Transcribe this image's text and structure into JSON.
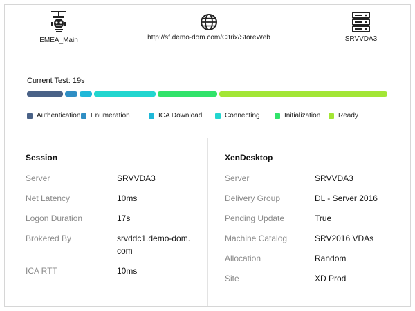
{
  "topology": {
    "site": {
      "label": "EMEA_Main",
      "icon": "robot-monitor-icon"
    },
    "url": {
      "label": "http://sf.demo-dom.com/Citrix/StoreWeb",
      "icon": "globe-icon"
    },
    "server": {
      "label": "SRVVDA3",
      "icon": "server-icon"
    }
  },
  "current_test": {
    "label": "Current Test:",
    "value": "19s"
  },
  "progress": {
    "segments": [
      {
        "name": "Authentication",
        "color": "#4a6287",
        "fraction": 0.105
      },
      {
        "name": "Enumeration",
        "color": "#2f8ec4",
        "fraction": 0.04
      },
      {
        "name": "ICA Download",
        "color": "#1fb8d8",
        "fraction": 0.04
      },
      {
        "name": "Connecting",
        "color": "#22d6cf",
        "fraction": 0.175
      },
      {
        "name": "Initialization",
        "color": "#31e36a",
        "fraction": 0.17
      },
      {
        "name": "Ready",
        "color": "#a3e635",
        "fraction": 0.465
      }
    ]
  },
  "legend": [
    {
      "label": "Authentication",
      "color": "#4a6287"
    },
    {
      "label": "Enumeration",
      "color": "#2f8ec4"
    },
    {
      "label": "ICA Download",
      "color": "#1fb8d8"
    },
    {
      "label": "Connecting",
      "color": "#22d6cf"
    },
    {
      "label": "Initialization",
      "color": "#31e36a"
    },
    {
      "label": "Ready",
      "color": "#a3e635"
    }
  ],
  "session": {
    "title": "Session",
    "rows": [
      {
        "key": "Server",
        "value": "SRVVDA3"
      },
      {
        "key": "Net Latency",
        "value": "10ms"
      },
      {
        "key": "Logon Duration",
        "value": "17s"
      },
      {
        "key": "Brokered By",
        "value": "srvddc1.demo-dom.com"
      },
      {
        "key": "ICA RTT",
        "value": "10ms"
      }
    ]
  },
  "xendesktop": {
    "title": "XenDesktop",
    "rows": [
      {
        "key": "Server",
        "value": "SRVVDA3"
      },
      {
        "key": "Delivery Group",
        "value": "DL - Server 2016"
      },
      {
        "key": "Pending Update",
        "value": "True"
      },
      {
        "key": "Machine Catalog",
        "value": "SRV2016 VDAs"
      },
      {
        "key": "Allocation",
        "value": "Random"
      },
      {
        "key": "Site",
        "value": "XD Prod"
      }
    ]
  }
}
